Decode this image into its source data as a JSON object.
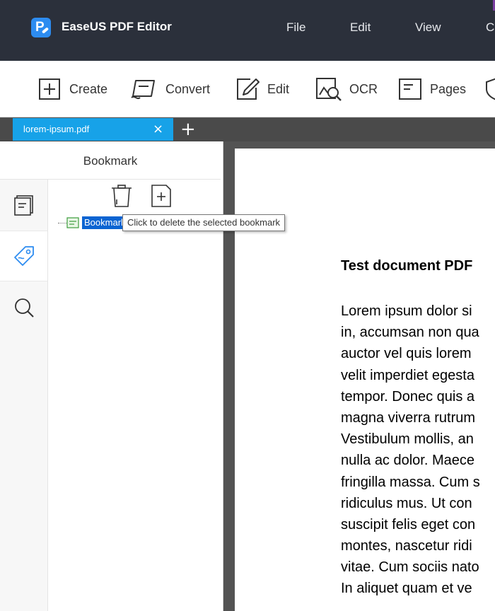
{
  "titlebar": {
    "app_name": "EaseUS PDF Editor",
    "menu": [
      "File",
      "Edit",
      "View",
      "C"
    ],
    "colors": {
      "background": "#2b303b",
      "logo": "#2d8cf0"
    }
  },
  "toolbar": {
    "tools": [
      {
        "label": "Create",
        "icon": "create-icon"
      },
      {
        "label": "Convert",
        "icon": "convert-icon"
      },
      {
        "label": "Edit",
        "icon": "edit-icon"
      },
      {
        "label": "OCR",
        "icon": "ocr-icon"
      },
      {
        "label": "Pages",
        "icon": "pages-icon"
      }
    ]
  },
  "tabs": {
    "active_tab": "lorem-ipsum.pdf",
    "close_glyph": "×",
    "new_tab_glyph": "+",
    "colors": {
      "active": "#17a2e8",
      "bar": "#4a4a4a"
    }
  },
  "sidepanel": {
    "title": "Bookmark",
    "rail": [
      "thumbnails-icon",
      "bookmark-icon",
      "search-icon"
    ],
    "bookmark_item": "Bookmark",
    "tooltip": "Click to delete the selected bookmark",
    "colors": {
      "selection": "#0a64d2",
      "active_icon": "#2d8cf0"
    }
  },
  "document": {
    "title": "Test document PDF",
    "lines": [
      "Lorem ipsum dolor si",
      "in, accumsan non qua",
      "auctor vel quis lorem",
      "velit imperdiet egesta",
      "tempor. Donec quis a",
      "magna viverra rutrum",
      "Vestibulum mollis, an",
      "nulla ac dolor. Maece",
      "fringilla massa. Cum s",
      "ridiculus mus. Ut con",
      "suscipit felis eget con",
      "montes, nascetur ridi",
      "vitae. Cum sociis nato",
      "In aliquet quam et ve"
    ]
  }
}
